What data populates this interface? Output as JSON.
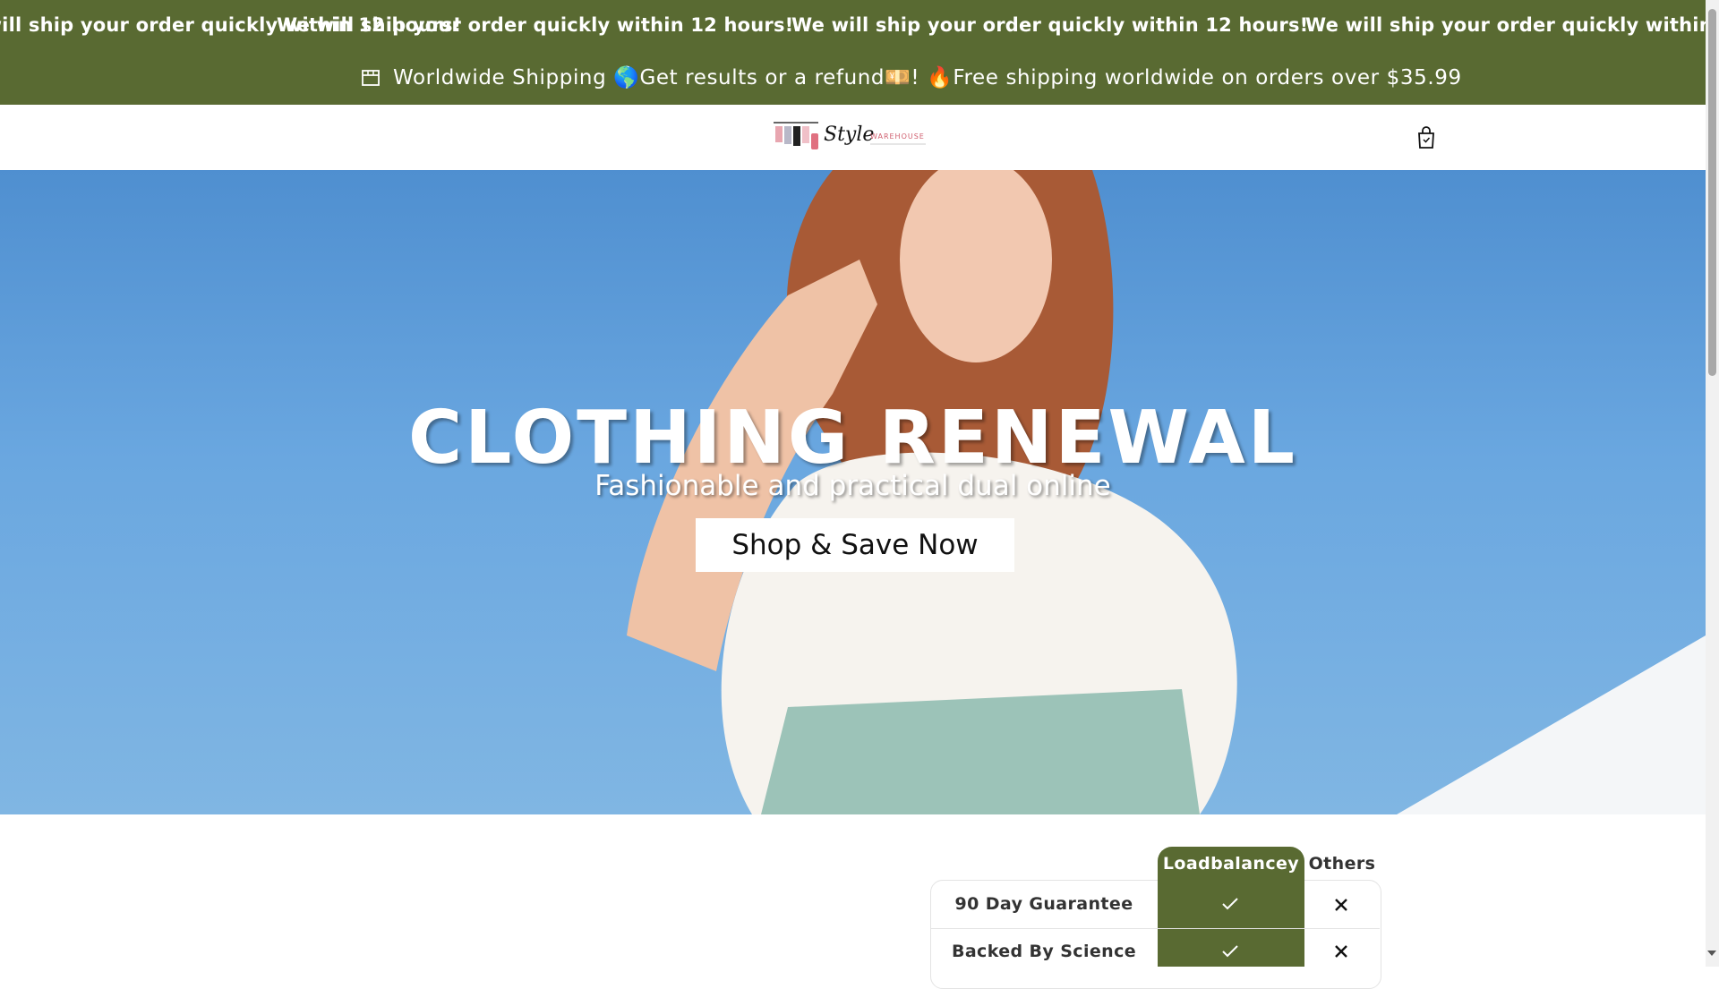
{
  "marquee": {
    "items": [
      "We will ship your order quickly within 12 hours!",
      "We will ship your order quickly within 12 hours!",
      "We will ship your order quickly within 12 hours!",
      "We will ship your order quickly within 12 hours!"
    ]
  },
  "announcement": {
    "text": "Worldwide Shipping 🌎Get results or a refund💴! 🔥Free shipping worldwide on orders over $35.99",
    "icon": "store-icon"
  },
  "header": {
    "logo_text": "Style",
    "logo_subtext": "WAREHOUSE",
    "cart_icon": "cart-icon"
  },
  "hero": {
    "title": "CLOTHING RENEWAL",
    "subtitle": "Fashionable and practical dual online",
    "cta_label": "Shop & Save Now"
  },
  "comparison": {
    "columns": [
      "Loadbalancey",
      "Others"
    ],
    "rows": [
      {
        "label": "90 Day Guarantee",
        "ours": true,
        "others": false
      },
      {
        "label": "Backed By Science",
        "ours": true,
        "others": false
      }
    ],
    "accent_color": "#596a32"
  },
  "colors": {
    "brand": "#596a32",
    "sky": "#6aa7e0"
  }
}
